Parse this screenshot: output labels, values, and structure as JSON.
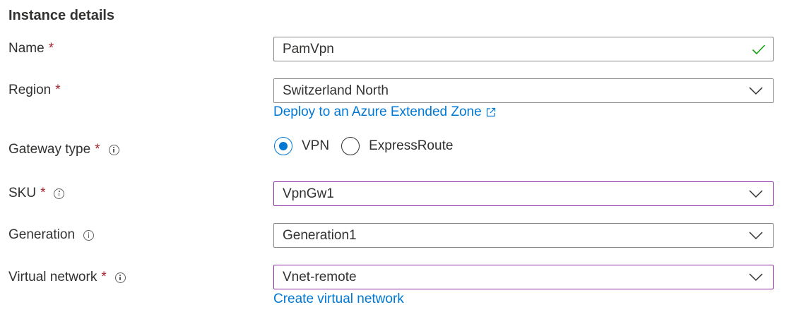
{
  "section": {
    "title": "Instance details"
  },
  "required_mark": "*",
  "name": {
    "label": "Name",
    "value": "PamVpn"
  },
  "region": {
    "label": "Region",
    "value": "Switzerland North",
    "link": "Deploy to an Azure Extended Zone"
  },
  "gateway_type": {
    "label": "Gateway type",
    "options": [
      "VPN",
      "ExpressRoute"
    ],
    "selected": "VPN"
  },
  "sku": {
    "label": "SKU",
    "value": "VpnGw1"
  },
  "generation": {
    "label": "Generation",
    "value": "Generation1"
  },
  "virtual_network": {
    "label": "Virtual network",
    "value": "Vnet-remote",
    "link": "Create virtual network"
  },
  "colors": {
    "accent": "#0078d4",
    "required": "#a4262c",
    "valid_check": "#13a10e",
    "focus_border": "#8f2da6"
  }
}
